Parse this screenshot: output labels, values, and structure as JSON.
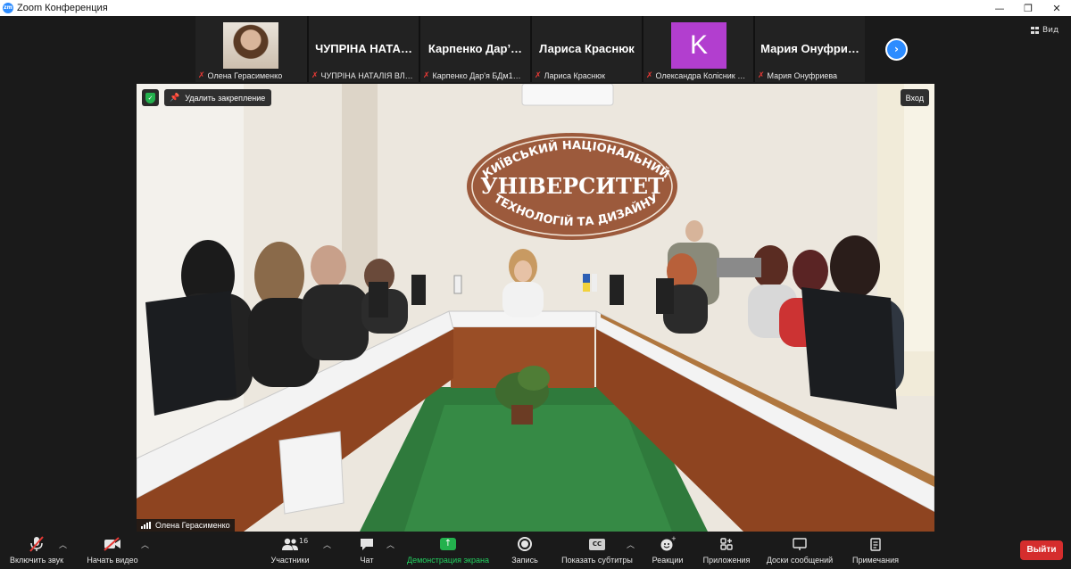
{
  "window": {
    "app_logo": "zm",
    "title": "Zoom Конференция",
    "controls": [
      "—",
      "❐",
      "✕"
    ]
  },
  "view_button": "Вид",
  "participants_strip": [
    {
      "display": "photo",
      "name": "Олена Герасименко",
      "muted": true
    },
    {
      "display": "name",
      "big_name": "ЧУПРІНА НАТА…",
      "name": "ЧУПРІНА НАТАЛІЯ ВЛ…",
      "muted": true
    },
    {
      "display": "name",
      "big_name": "Карпенко Дар’…",
      "name": "Карпенко Дар'я БДм1…",
      "muted": true
    },
    {
      "display": "name",
      "big_name": "Лариса Краснюк",
      "name": "Лариса Краснюк",
      "muted": true
    },
    {
      "display": "avatar",
      "initial": "K",
      "avatar_color": "#b23ecf",
      "name": "Олександра Колісник …",
      "muted": true
    },
    {
      "display": "name",
      "big_name": "Мария Онуфри…",
      "name": "Мария Онуфриева",
      "muted": true
    }
  ],
  "main_video": {
    "unpin_label": "Удалить закрепление",
    "enter_label": "Вход",
    "speaker_name": "Олена Герасименко",
    "sign": {
      "top_text": "КИЇВСЬКИЙ НАЦІОНАЛЬНИЙ",
      "middle_text": "УНІВЕРСИТЕТ",
      "bottom_text": "ТЕХНОЛОГІЙ ТА ДИЗАЙНУ"
    }
  },
  "toolbar": {
    "mute": {
      "label": "Включить звук",
      "icon": "mic-muted-icon"
    },
    "video": {
      "label": "Начать видео",
      "icon": "video-off-icon"
    },
    "participants": {
      "label": "Участники",
      "count": "16",
      "icon": "participants-icon"
    },
    "chat": {
      "label": "Чат",
      "icon": "chat-icon"
    },
    "share": {
      "label": "Демонстрация экрана",
      "icon": "share-screen-icon",
      "color": "#23d160"
    },
    "record": {
      "label": "Запись",
      "icon": "record-icon"
    },
    "captions": {
      "label": "Показать субтитры",
      "badge": "CC",
      "icon": "captions-icon"
    },
    "reactions": {
      "label": "Реакции",
      "icon": "reactions-icon"
    },
    "apps": {
      "label": "Приложения",
      "icon": "apps-icon"
    },
    "whiteboards": {
      "label": "Доски сообщений",
      "icon": "whiteboard-icon"
    },
    "notes": {
      "label": "Примечания",
      "icon": "notes-icon"
    },
    "leave": {
      "label": "Выйти",
      "color": "#d52d2d"
    }
  }
}
